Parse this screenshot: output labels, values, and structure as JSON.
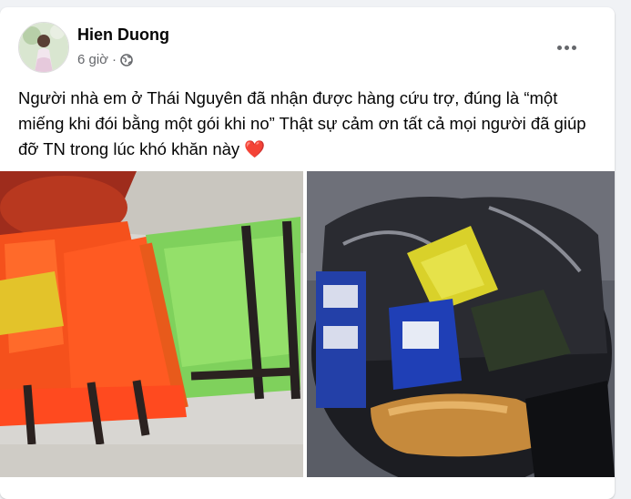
{
  "post": {
    "author": "Hien Duong",
    "time": "6 giờ",
    "separator": "·",
    "privacy_icon": "globe-icon",
    "more_icon": "more-options-icon",
    "text": "Người nhà em ở Thái Nguyên đã nhận được hàng cứu trợ, đúng là “một miếng khi đói bằng một gói khi no” Thật sự cảm ơn tất cả mọi người đã giúp đỡ TN trong lúc khó khăn này",
    "emoji": "❤️"
  },
  "photos": [
    {
      "name": "life-jackets-photo"
    },
    {
      "name": "relief-goods-bag-photo"
    }
  ]
}
